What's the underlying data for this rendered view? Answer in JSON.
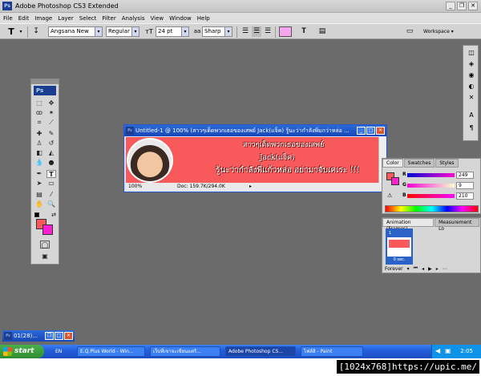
{
  "window": {
    "title": "Adobe Photoshop CS3 Extended",
    "app_badge": "Ps"
  },
  "menu": [
    "File",
    "Edit",
    "Image",
    "Layer",
    "Select",
    "Filter",
    "Analysis",
    "View",
    "Window",
    "Help"
  ],
  "options": {
    "font_family": "Angsana New",
    "font_style": "Regular",
    "font_size": "24 pt",
    "antialias": "Sharp",
    "text_color": "#f7a6ee",
    "workspace_label": "Workspace"
  },
  "tools_panel": {
    "badge": "Ps",
    "foreground_color": "#f85a5c",
    "background_color": "#ff1fd2"
  },
  "document": {
    "title": "Untitled-1 @ 100% (สาวๆเด็ดพวกเธอของเสพย์ Jack(แจ็ค) รู้นะว่ากำลังพิ่มกว่าหล่อ ...",
    "canvas_color": "#f85a5c",
    "text_lines": [
      "สาวๆเด็ดพวกเธอของเสพย์",
      "Jack(แจ็ค)",
      "รู้นะว่ากำลังพี่แก้วหล่อ อย่ามาจับเคเระ !!!"
    ],
    "zoom": "100%",
    "doc_size": "Doc: 159.7K/294.0K"
  },
  "color_panel": {
    "tabs": [
      "Color",
      "Swatches",
      "Styles"
    ],
    "channels": [
      {
        "label": "R",
        "value": "249"
      },
      {
        "label": "G",
        "value": "9"
      },
      {
        "label": "B",
        "value": "210"
      }
    ]
  },
  "animation_panel": {
    "tabs": [
      "Animation (Frames)",
      "Measurement Lo"
    ],
    "frame_number": "1",
    "frame_delay": "0 sec.",
    "loop": "Forever"
  },
  "minimized_doc": {
    "title": "01(28)..."
  },
  "taskbar": {
    "start_label": "start",
    "language": "EN",
    "items": [
      {
        "label": "E.Q.Plus World - Win..."
      },
      {
        "label": "เว็บที่เขาจะเขียนแต่ร้..."
      },
      {
        "label": "Adobe Photoshop CS..."
      },
      {
        "label": "ไฟล์ฮิ - Paint"
      }
    ],
    "clock": "2:05"
  },
  "caption": "[1024x768]https://upic.me/"
}
